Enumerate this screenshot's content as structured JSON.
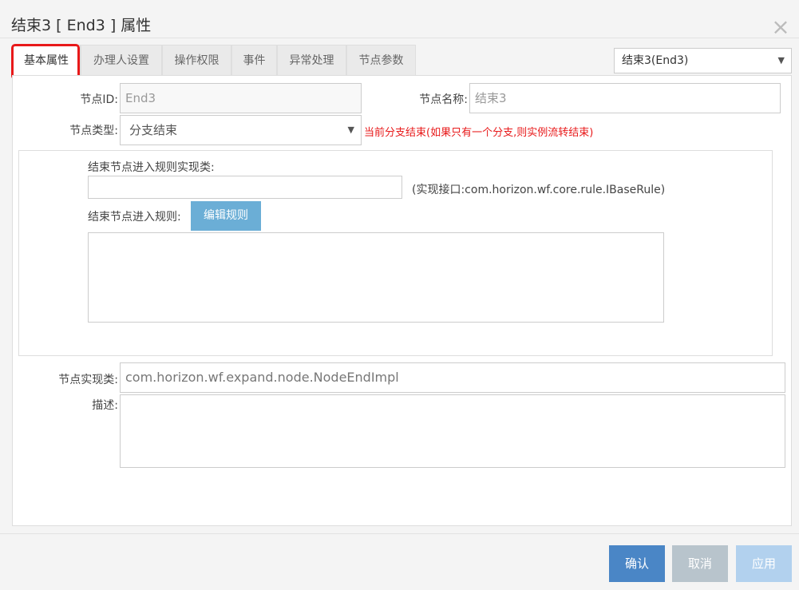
{
  "window": {
    "title": "结束3 [ End3 ] 属性",
    "close_glyph": "×"
  },
  "tabs": [
    {
      "label": "基本属性",
      "active": true
    },
    {
      "label": "办理人设置",
      "active": false
    },
    {
      "label": "操作权限",
      "active": false
    },
    {
      "label": "事件",
      "active": false
    },
    {
      "label": "异常处理",
      "active": false
    },
    {
      "label": "节点参数",
      "active": false
    }
  ],
  "node_select": {
    "value": "结束3(End3)",
    "arrow": "▼"
  },
  "form": {
    "node_id_label": "节点ID:",
    "node_id_value": "End3",
    "node_name_label": "节点名称:",
    "node_name_value": "结束3",
    "node_type_label": "节点类型:",
    "node_type_value": "分支结束",
    "node_type_arrow": "▼",
    "node_type_hint": "当前分支结束(如果只有一个分支,则实例流转结束)",
    "rule_class_label": "结束节点进入规则实现类:",
    "rule_class_value": "",
    "rule_interface_hint": "(实现接口:com.horizon.wf.core.rule.IBaseRule)",
    "rule_label": "结束节点进入规则:",
    "edit_rule_button": "编辑规则",
    "rule_text": "",
    "impl_class_label": "节点实现类:",
    "impl_class_value": "com.horizon.wf.expand.node.NodeEndImpl",
    "description_label": "描述:",
    "description_value": ""
  },
  "footer": {
    "confirm": "确认",
    "cancel": "取消",
    "apply": "应用"
  },
  "colors": {
    "accent": "#4a86c6",
    "highlight": "#e8191a",
    "edit_button": "#6baed6"
  }
}
